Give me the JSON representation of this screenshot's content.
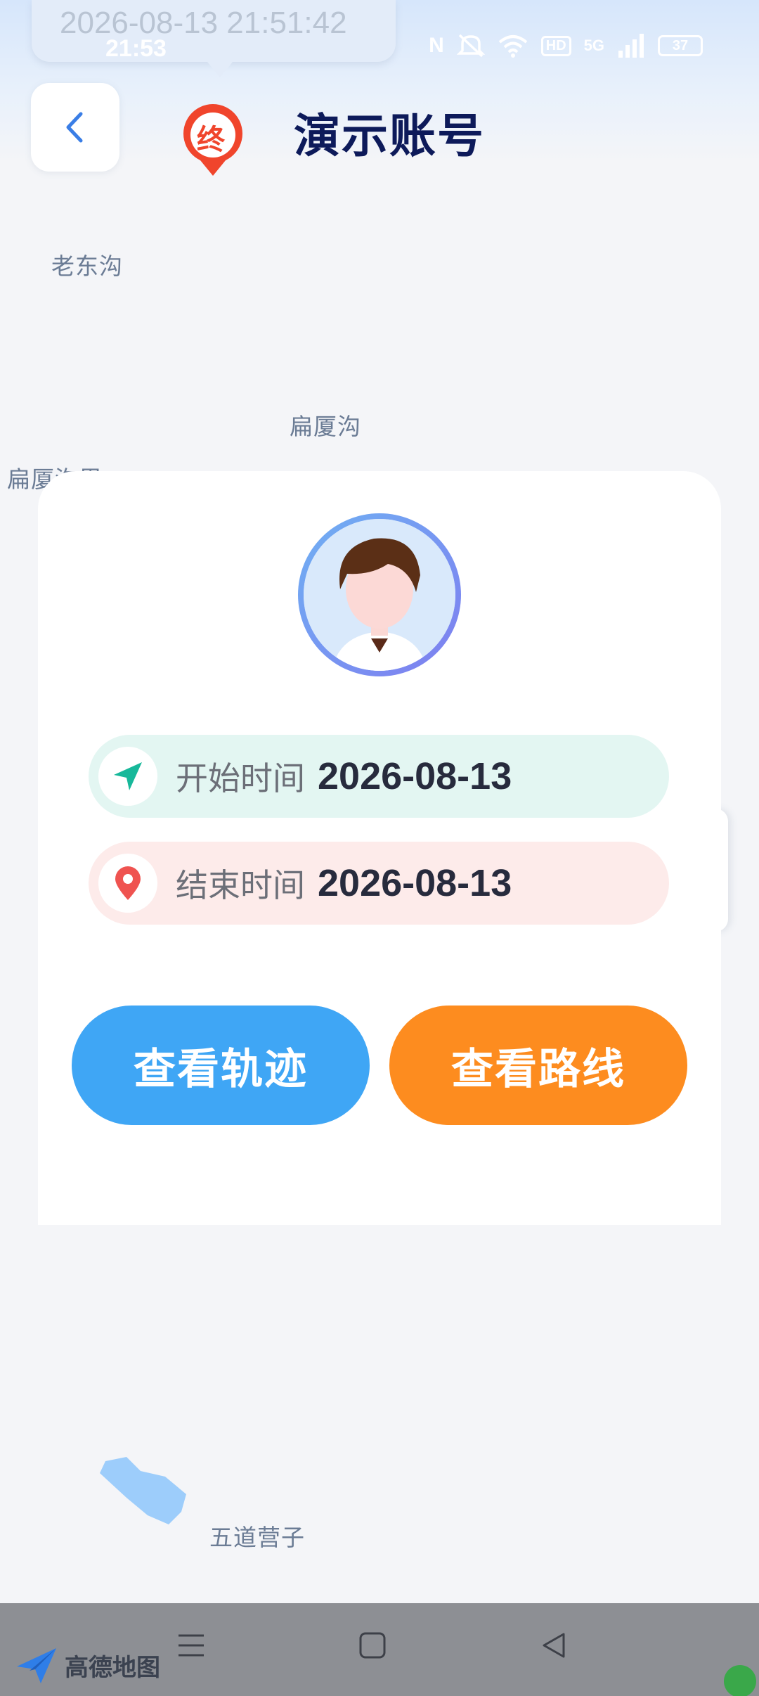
{
  "status_bar": {
    "notification_text": "2026-08-13 21:51:42",
    "time": "21:53",
    "nfc": "N",
    "hd": "HD",
    "network": "5G",
    "battery": "37"
  },
  "header": {
    "marker_label": "终",
    "title": "演示账号"
  },
  "map": {
    "labels": [
      "老东沟",
      "扁厦沟",
      "扁厦沟里",
      "五道营子"
    ]
  },
  "card": {
    "start_label": "开始时间",
    "start_value": "2026-08-13",
    "end_label": "结束时间",
    "end_value": "2026-08-13",
    "track_button": "查看轨迹",
    "route_button": "查看路线"
  },
  "footer": {
    "logo_text": "高德地图"
  },
  "colors": {
    "title": "#0d1a5a",
    "track_button": "#3fa6f5",
    "route_button": "#fd8c1f",
    "start_row": "#e3f6f2",
    "end_row": "#fdebea",
    "start_icon": "#17b89a",
    "end_icon": "#ef5350"
  },
  "icons": {
    "back": "chevron-left-icon",
    "end_marker": "end-location-pin-icon",
    "start": "navigation-arrow-icon",
    "end": "location-pin-icon"
  }
}
